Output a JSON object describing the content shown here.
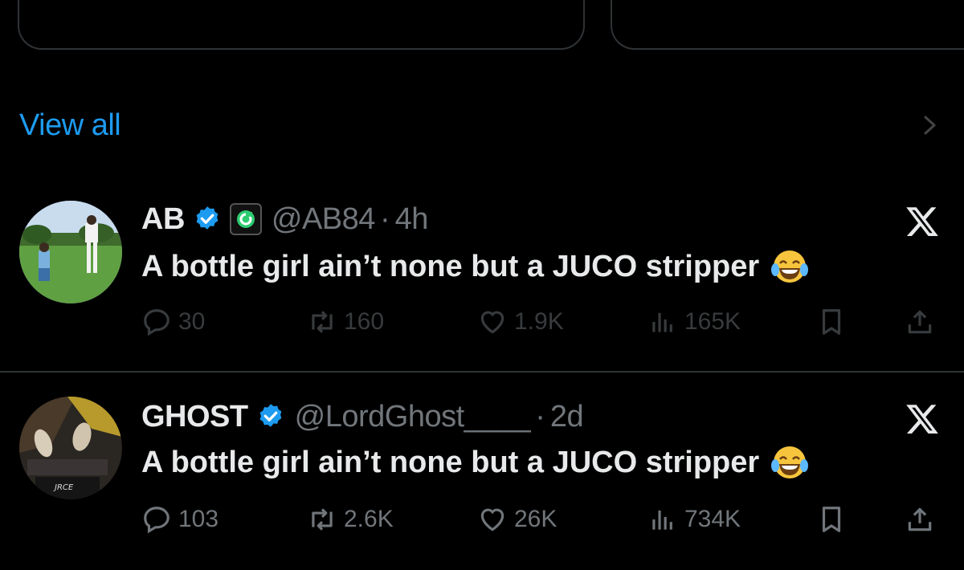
{
  "view_all": {
    "label": "View all"
  },
  "tweets": [
    {
      "name": "AB",
      "handle": "@AB84",
      "separator": "·",
      "time": "4h",
      "text": "A bottle girl ain’t none but a JUCO stripper",
      "has_affiliate_badge": true,
      "stats": {
        "replies": "30",
        "reposts": "160",
        "likes": "1.9K",
        "views": "165K"
      }
    },
    {
      "name": "GHOST",
      "handle": "@LordGhost____",
      "separator": "·",
      "time": "2d",
      "text": "A bottle girl ain’t none but a JUCO stripper",
      "has_affiliate_badge": false,
      "stats": {
        "replies": "103",
        "reposts": "2.6K",
        "likes": "26K",
        "views": "734K"
      }
    }
  ],
  "colors": {
    "background": "#000000",
    "text_primary": "#e7e9ea",
    "text_secondary": "#71767b",
    "accent": "#1d9bf0",
    "divider": "#2f3336"
  },
  "icons": {
    "verified": "verified-badge-icon",
    "x_logo": "x-logo-icon",
    "reply": "speech-bubble-icon",
    "repost": "repost-arrows-icon",
    "like": "heart-icon",
    "views": "bar-chart-icon",
    "bookmark": "bookmark-icon",
    "share": "share-upload-icon",
    "emoji": "tears-of-joy-emoji"
  }
}
